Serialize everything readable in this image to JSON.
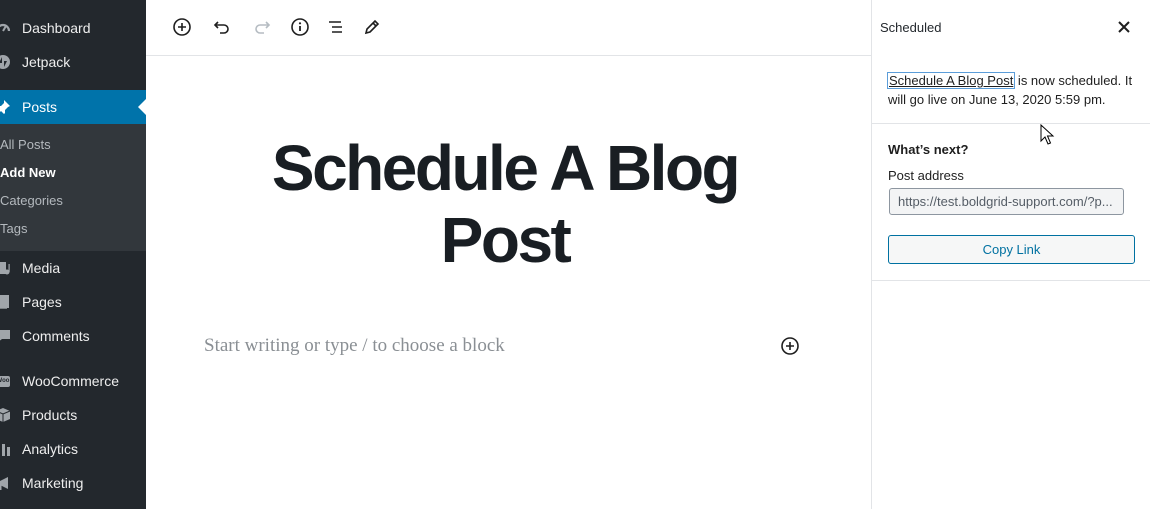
{
  "sidebar": {
    "dashboard": "Dashboard",
    "jetpack": "Jetpack",
    "posts": "Posts",
    "submenu": {
      "all_posts": "All Posts",
      "add_new": "Add New",
      "categories": "Categories",
      "tags": "Tags"
    },
    "media": "Media",
    "pages": "Pages",
    "comments": "Comments",
    "woocommerce": "WooCommerce",
    "woo_icon_text": "Woo",
    "products": "Products",
    "analytics": "Analytics",
    "marketing": "Marketing"
  },
  "editor": {
    "post_title": "Schedule A Blog Post",
    "block_placeholder": "Start writing or type / to choose a block"
  },
  "panel": {
    "title": "Scheduled",
    "notice_link": "Schedule A Blog Post",
    "notice_text": " is now scheduled. It will go live on June 13, 2020 5:59 pm.",
    "whats_next": "What’s next?",
    "post_address_label": "Post address",
    "post_address_value": "https://test.boldgrid-support.com/?p...",
    "copy_link": "Copy Link"
  },
  "colors": {
    "sidebar_bg": "#23282d",
    "submenu_bg": "#32373c",
    "accent": "#0073aa",
    "button_blue": "#0071a1"
  }
}
